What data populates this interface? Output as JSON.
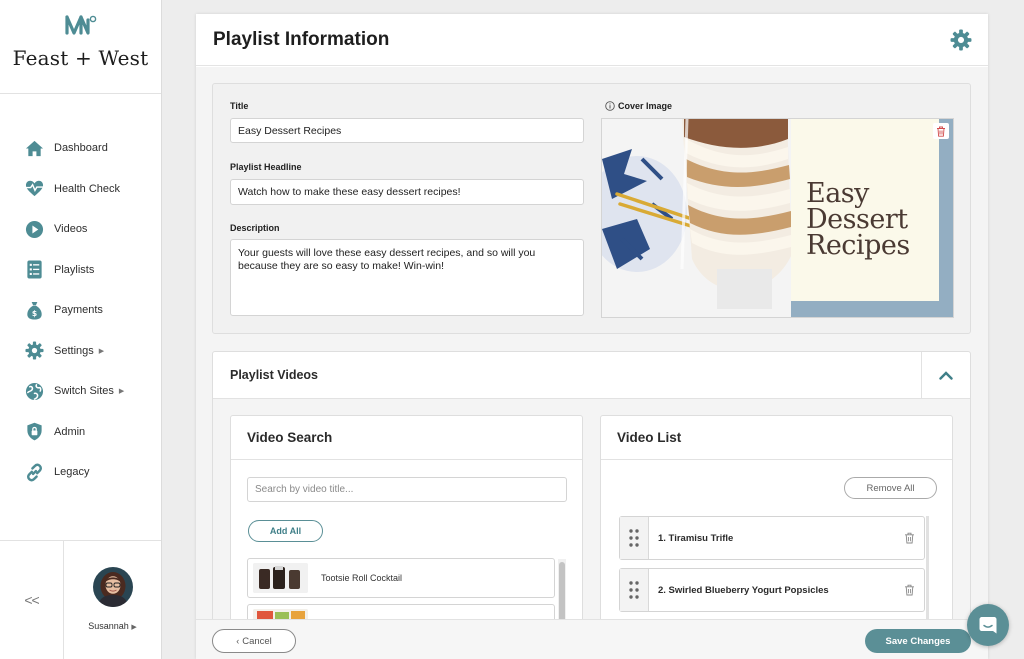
{
  "app": {
    "brand_name": "Feast + West"
  },
  "sidebar": {
    "items": [
      {
        "label": "Dashboard",
        "icon": "house-icon",
        "has_arrow": false
      },
      {
        "label": "Health Check",
        "icon": "heartbeat-icon",
        "has_arrow": false
      },
      {
        "label": "Videos",
        "icon": "play-circle-icon",
        "has_arrow": false
      },
      {
        "label": "Playlists",
        "icon": "list-icon",
        "has_arrow": false
      },
      {
        "label": "Payments",
        "icon": "money-bag-icon",
        "has_arrow": false
      },
      {
        "label": "Settings",
        "icon": "gear-icon",
        "has_arrow": true
      },
      {
        "label": "Switch Sites",
        "icon": "globe-icon",
        "has_arrow": true
      },
      {
        "label": "Admin",
        "icon": "shield-lock-icon",
        "has_arrow": false
      },
      {
        "label": "Legacy",
        "icon": "link-icon",
        "has_arrow": false
      }
    ],
    "collapse_symbol": "<<",
    "user_name": "Susannah"
  },
  "header": {
    "title": "Playlist Information"
  },
  "form": {
    "title_label": "Title",
    "title_value": "Easy Dessert Recipes",
    "headline_label": "Playlist Headline",
    "headline_value": "Watch how to make these easy dessert recipes!",
    "description_label": "Description",
    "description_value": "Your guests will love these easy dessert recipes, and so will you because they are so easy to make! Win-win!",
    "cover_label": "Cover Image",
    "cover_text": [
      "Easy",
      "Dessert",
      "Recipes"
    ]
  },
  "playlist_videos": {
    "title": "Playlist Videos",
    "search": {
      "title": "Video Search",
      "placeholder": "Search by video title...",
      "add_all_label": "Add All",
      "results": [
        {
          "title": "Tootsie Roll Cocktail"
        },
        {
          "title": ""
        }
      ]
    },
    "list": {
      "title": "Video List",
      "remove_all_label": "Remove All",
      "items": [
        {
          "title": "1. Tiramisu Trifle"
        },
        {
          "title": "2. Swirled Blueberry Yogurt Popsicles"
        }
      ]
    }
  },
  "footer": {
    "cancel_label": "Cancel",
    "save_label": "Save Changes"
  },
  "colors": {
    "accent": "#3f7f88",
    "button_fill": "#5b8f96",
    "cover_frame_blue": "#93aec2",
    "cover_text_bg": "#fbf9ea"
  }
}
